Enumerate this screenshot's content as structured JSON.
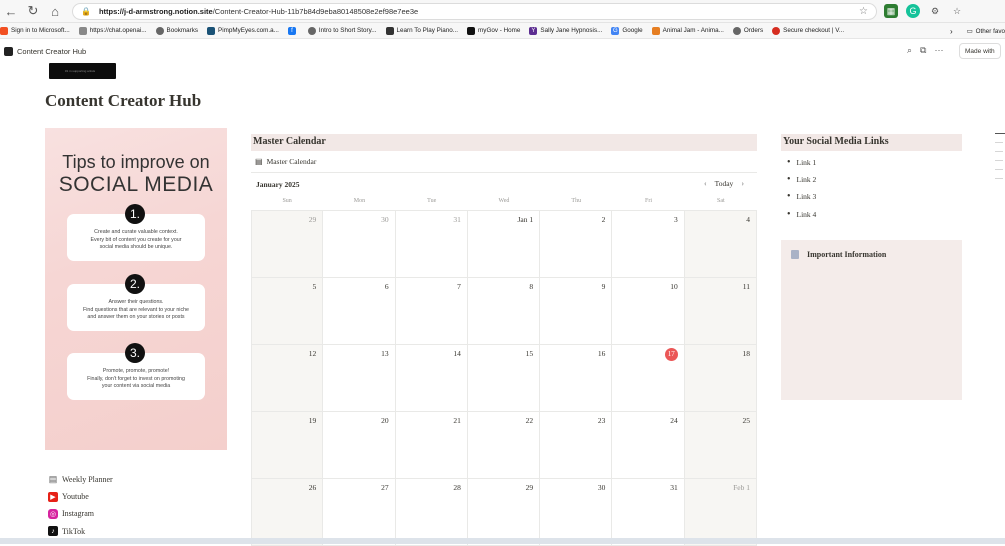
{
  "browser": {
    "url_host": "https://j-d-armstrong.notion.site",
    "url_path": "/Content-Creator-Hub-11b7b84d9eba80148508e2ef98e7ee3e"
  },
  "bookmarks": [
    {
      "label": "Sign in to Microsoft...",
      "color": "#f25022"
    },
    {
      "label": "https://chat.openai...",
      "color": "#555555"
    },
    {
      "label": "Bookmarks",
      "color": "#666666"
    },
    {
      "label": "PimpMyEyes.com.a...",
      "color": "#1a5276"
    },
    {
      "label": "",
      "color": "#1877f2"
    },
    {
      "label": "Intro to Short Story...",
      "color": "#666666"
    },
    {
      "label": "Learn To Play Piano...",
      "color": "#333333"
    },
    {
      "label": "myGov - Home",
      "color": "#111111"
    },
    {
      "label": "Sally Jane Hypnosis...",
      "color": "#5c2d91"
    },
    {
      "label": "Google",
      "color": "#4285f4"
    },
    {
      "label": "Animal Jam - Anima...",
      "color": "#e67e22"
    },
    {
      "label": "Orders",
      "color": "#666666"
    },
    {
      "label": "Secure checkout | V...",
      "color": "#d62d20"
    }
  ],
  "bookmarks_other": "Other favo",
  "notion": {
    "breadcrumb": "Content Creator Hub",
    "made_with": "Made with"
  },
  "page": {
    "title": "Content Creator Hub",
    "cover_caption": "#1 in supporting artists"
  },
  "tips": {
    "line1": "Tips to improve on",
    "line2": "SOCIAL MEDIA",
    "items": [
      {
        "num": "1.",
        "text1": "Create and curate valuable context.",
        "text2": "Every bit of content you create for your",
        "text3": "social media should be unique."
      },
      {
        "num": "2.",
        "text1": "Answer their questions.",
        "text2": "Find questions that are relevant to your niche",
        "text3": "and answer them on your stories or posts"
      },
      {
        "num": "3.",
        "text1": "Promote, promote, promote!",
        "text2": "Finally, don't forget to invest on promoting",
        "text3": "your content via social media"
      }
    ]
  },
  "side_links": [
    {
      "label": "Weekly Planner",
      "icon": "calendar-icon"
    },
    {
      "label": "Youtube",
      "icon": "youtube-icon"
    },
    {
      "label": "Instagram",
      "icon": "instagram-icon"
    },
    {
      "label": "TikTok",
      "icon": "tiktok-icon"
    }
  ],
  "calendar": {
    "header": "Master Calendar",
    "view_tab": "Master Calendar",
    "month": "January 2025",
    "today_label": "Today",
    "weekdays": [
      "Sun",
      "Mon",
      "Tue",
      "Wed",
      "Thu",
      "Fri",
      "Sat"
    ],
    "weeks": [
      [
        "29",
        "30",
        "31",
        "Jan 1",
        "2",
        "3",
        "4"
      ],
      [
        "5",
        "6",
        "7",
        "8",
        "9",
        "10",
        "11"
      ],
      [
        "12",
        "13",
        "14",
        "15",
        "16",
        "17",
        "18"
      ],
      [
        "19",
        "20",
        "21",
        "22",
        "23",
        "24",
        "25"
      ],
      [
        "26",
        "27",
        "28",
        "29",
        "30",
        "31",
        "Feb 1"
      ]
    ],
    "dim_days": [
      "0-0",
      "0-1",
      "0-2",
      "4-6"
    ],
    "today_cell": "2-5",
    "today_color": "#eb5757"
  },
  "social": {
    "header": "Your Social Media Links",
    "links": [
      "Link 1",
      "Link 2",
      "Link 3",
      "Link 4"
    ]
  },
  "info": {
    "title": "Important Information"
  }
}
